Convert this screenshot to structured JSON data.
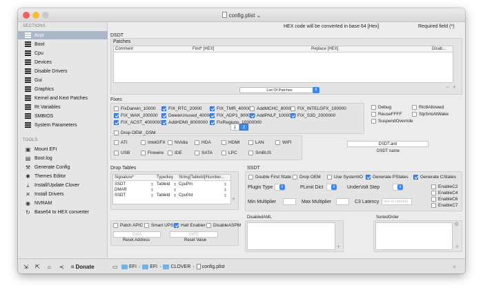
{
  "window": {
    "title": "config.plist"
  },
  "header": {
    "notice": "HEX code will be converted in base 64 [Hex]",
    "required": "Required field (*)"
  },
  "sidebar": {
    "sections_heading": "SECTIONS",
    "tools_heading": "TOOLS",
    "sections": [
      {
        "label": "Acpi",
        "selected": true
      },
      {
        "label": "Boot"
      },
      {
        "label": "Cpu"
      },
      {
        "label": "Devices"
      },
      {
        "label": "Disable Drivers"
      },
      {
        "label": "Gui"
      },
      {
        "label": "Graphics"
      },
      {
        "label": "Kernel and Kext Patches"
      },
      {
        "label": "Rt Variables"
      },
      {
        "label": "SMBIOS"
      },
      {
        "label": "System Parameters"
      }
    ],
    "tools": [
      {
        "label": "Mount EFI",
        "icon": "disk-icon"
      },
      {
        "label": "Boot.log",
        "icon": "log-icon"
      },
      {
        "label": "Generate Config",
        "icon": "wrench-icon"
      },
      {
        "label": "Themes Editor",
        "icon": "palette-icon"
      },
      {
        "label": "Install/Update Clover",
        "icon": "download-icon"
      },
      {
        "label": "Install Drivers",
        "icon": "tools-icon"
      },
      {
        "label": "NVRAM",
        "icon": "chip-icon"
      },
      {
        "label": "Base64 to HEX converter",
        "icon": "convert-icon"
      }
    ]
  },
  "dsdt": {
    "heading": "DSDT",
    "patches_heading": "Patches",
    "patches_columns": [
      "Comment",
      "Find* [HEX]",
      "Replace [HEX]",
      "Disab..."
    ],
    "list_popup": "List Of Patches",
    "fixes_heading": "Fixes",
    "fixes": [
      {
        "label": "FixDarwin_10000",
        "on": false
      },
      {
        "label": "FIX_RTC_20000",
        "on": true
      },
      {
        "label": "FIX_TMR_40000",
        "on": true
      },
      {
        "label": "AddMCHC_80000",
        "on": false
      },
      {
        "label": "FIX_INTELGFX_100000",
        "on": false
      },
      {
        "label": "FIX_WAK_200000",
        "on": true
      },
      {
        "label": "DeleteUnused_400000",
        "on": true
      },
      {
        "label": "FIX_ADP1_800000",
        "on": true
      },
      {
        "label": "AddPNLF_1000000",
        "on": true
      },
      {
        "label": "FIX_S3D_2000000",
        "on": true
      },
      {
        "label": "FIX_ACST_4000000",
        "on": true
      },
      {
        "label": "AddHDMI_8000000",
        "on": true
      },
      {
        "label": "FixRegions_10000000",
        "on": true
      }
    ],
    "side_options": [
      {
        "label": "Debug",
        "on": false
      },
      {
        "label": "Rtc8Allowed",
        "on": false
      },
      {
        "label": "ReuseFFFF",
        "on": false
      },
      {
        "label": "SlpSmiAtWake",
        "on": false
      },
      {
        "label": "SuspendOverride",
        "on": false
      }
    ],
    "pages": [
      "1",
      "2"
    ],
    "active_page": "2",
    "drop_oem_dsm": "Drop OEM _DSM",
    "dsm_row1": [
      "ATI",
      "IntelGFX",
      "NVidia",
      "HDA",
      "HDMI",
      "LAN",
      "WIFI"
    ],
    "dsm_row2": [
      "USB",
      "Firewire",
      "IDE",
      "SATA",
      "LPC",
      "SmBUS"
    ],
    "dsdt_file": "DSDT.aml",
    "dsdt_name_label": "DSDT name"
  },
  "drop_tables": {
    "heading": "Drop Tables",
    "columns": [
      "Signature*",
      "Type/key",
      "String[TableId]/Number..."
    ],
    "rows": [
      {
        "sig": "SSDT",
        "type": "TableId",
        "value": "CpuPm"
      },
      {
        "sig": "DMAR",
        "type": "",
        "value": ""
      },
      {
        "sig": "SSDT",
        "type": "TableId",
        "value": "Cpu0Ist"
      }
    ]
  },
  "ssdt": {
    "heading": "SSDT",
    "checks": [
      {
        "label": "Double First State",
        "on": false
      },
      {
        "label": "Drop OEM",
        "on": false
      },
      {
        "label": "Use SystemIO",
        "on": false
      },
      {
        "label": "Generate PStates",
        "on": true
      },
      {
        "label": "Generate CStates",
        "on": true
      }
    ],
    "plugin_type": "Plugin Type",
    "plimit_dict": "PLimit Dict",
    "undervolt_step": "UnderVolt Step",
    "min_multiplier": "Min Multiplier",
    "max_multiplier": "Max Multiplier",
    "c3_latency": "C3 Latency",
    "c3_placeholder": "hex or number",
    "enable": [
      {
        "label": "EnableC2",
        "on": false
      },
      {
        "label": "EnableC4",
        "on": false
      },
      {
        "label": "EnableC6",
        "on": false
      },
      {
        "label": "EnableC7",
        "on": false
      }
    ]
  },
  "misc": {
    "checks": [
      {
        "label": "Patch APIC",
        "on": false
      },
      {
        "label": "Smart UPS",
        "on": false
      },
      {
        "label": "Halt Enabler",
        "on": true
      },
      {
        "label": "DisableASPM",
        "on": false
      }
    ],
    "reset_address_value": "0x64",
    "reset_address_label": "Reset Address",
    "reset_value_value": "0xFE",
    "reset_value_label": "Reset Value"
  },
  "disabled_aml": {
    "heading": "DisabledAML"
  },
  "sorted_order": {
    "heading": "SortedOrder"
  },
  "bottom": {
    "donate": "Donate",
    "path": [
      "EFI",
      "EFI",
      "CLOVER",
      "config.plist"
    ]
  },
  "colors": {
    "accent": "#3b88f5",
    "selection": "#a9b7c9",
    "folder": "#6db3e8"
  }
}
